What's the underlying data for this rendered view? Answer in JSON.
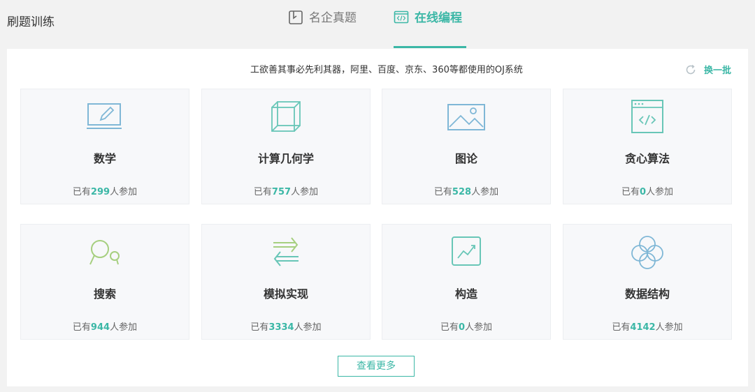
{
  "page_title": "刷题训练",
  "tabs": [
    {
      "label": "名企真题",
      "icon": "notebook-icon",
      "active": false
    },
    {
      "label": "在线编程",
      "icon": "code-window-icon",
      "active": true
    }
  ],
  "slogan": "工欲善其事必先利其器，阿里、百度、京东、360等都使用的OJ系统",
  "refresh": {
    "label": "换一批",
    "icon": "refresh-icon"
  },
  "count_prefix": "已有",
  "count_suffix": "人参加",
  "categories": [
    {
      "name": "数学",
      "count": "299",
      "icon": "pencil-board-icon"
    },
    {
      "name": "计算几何学",
      "count": "757",
      "icon": "cube-icon"
    },
    {
      "name": "图论",
      "count": "528",
      "icon": "landscape-image-icon"
    },
    {
      "name": "贪心算法",
      "count": "0",
      "icon": "code-browser-icon"
    },
    {
      "name": "搜索",
      "count": "944",
      "icon": "search-bubbles-icon"
    },
    {
      "name": "模拟实现",
      "count": "3334",
      "icon": "swap-arrows-icon"
    },
    {
      "name": "构造",
      "count": "0",
      "icon": "trend-chart-icon"
    },
    {
      "name": "数据结构",
      "count": "4142",
      "icon": "overlapping-circles-icon"
    }
  ],
  "more_button": "查看更多",
  "colors": {
    "accent": "#3bb7a6",
    "icon_blue": "#7fb7d6",
    "icon_teal": "#68c6b7",
    "icon_green": "#a6cf7f",
    "card_bg": "#f7f8fa"
  }
}
